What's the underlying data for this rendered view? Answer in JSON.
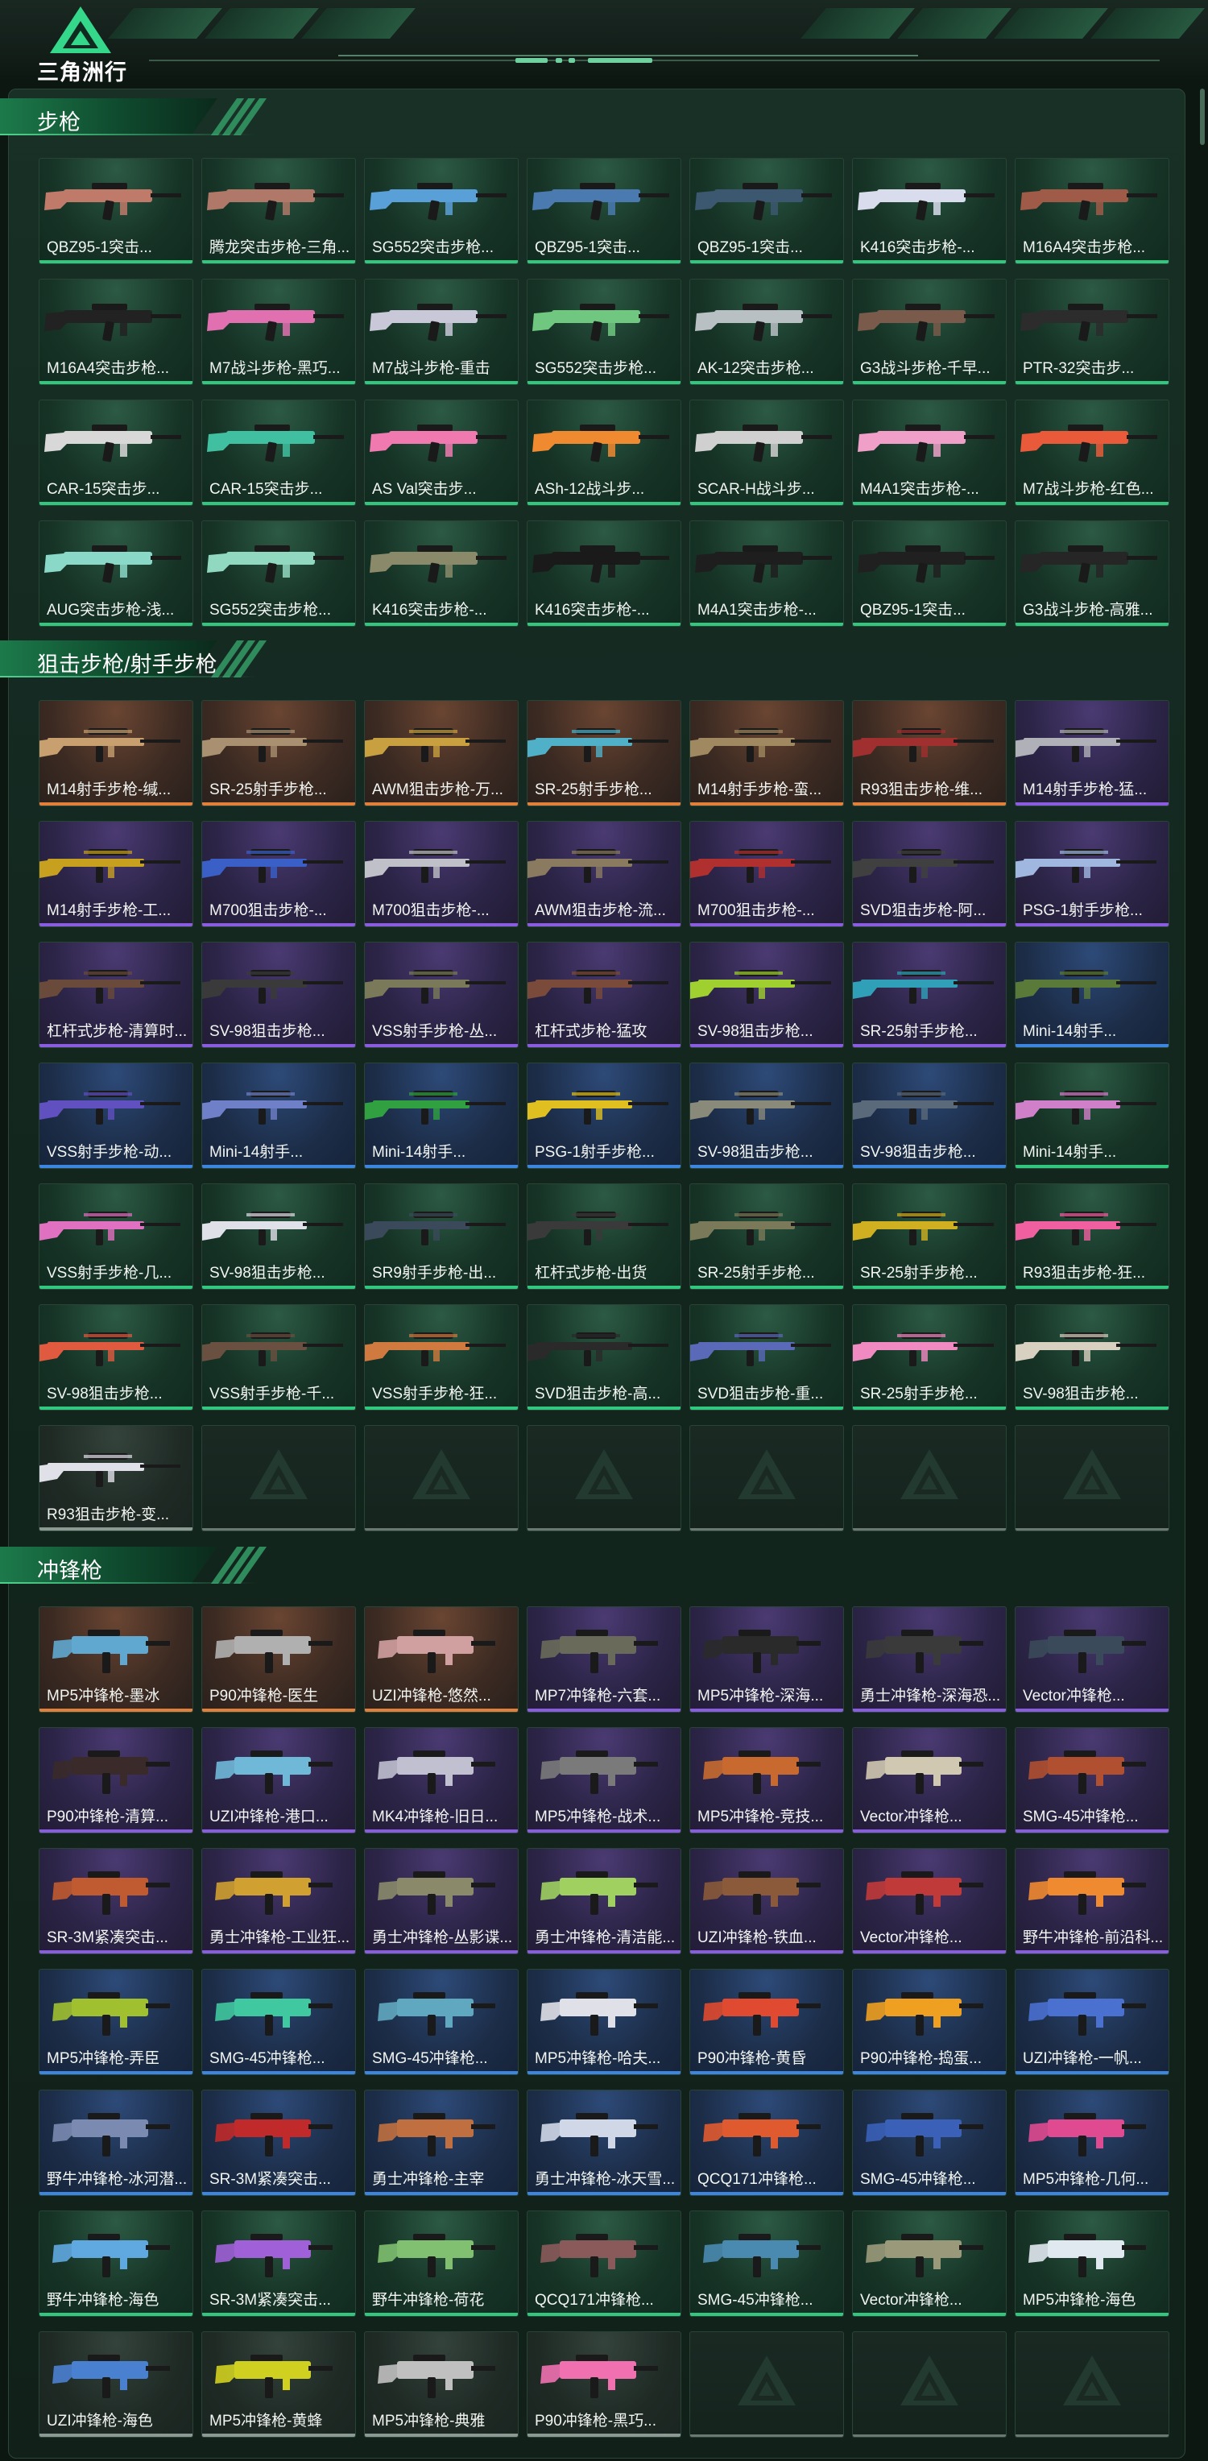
{
  "header": {
    "logo_text": "三角洲行动",
    "logo_icon": "delta-triangle-logo"
  },
  "colors": {
    "common": "#32c77f",
    "rare": "#3d86e0",
    "epic": "#8a5ce0",
    "legendary": "#e0803a",
    "empty": "#6c7872"
  },
  "sections": [
    {
      "title": "步枪",
      "items": [
        {
          "label": "QBZ95-1突击...",
          "rarity": "green",
          "color": "#c07a6a"
        },
        {
          "label": "腾龙突击步枪-三角...",
          "rarity": "green",
          "color": "#b07868"
        },
        {
          "label": "SG552突击步枪...",
          "rarity": "green",
          "color": "#5aa0d8"
        },
        {
          "label": "QBZ95-1突击...",
          "rarity": "green",
          "color": "#4a7ab0"
        },
        {
          "label": "QBZ95-1突击...",
          "rarity": "green",
          "color": "#3c5870"
        },
        {
          "label": "K416突击步枪-...",
          "rarity": "green",
          "color": "#d8dcec"
        },
        {
          "label": "M16A4突击步枪...",
          "rarity": "green",
          "color": "#a05a48"
        },
        {
          "label": "M16A4突击步枪...",
          "rarity": "green",
          "color": "#222222"
        },
        {
          "label": "M7战斗步枪-黑巧...",
          "rarity": "green",
          "color": "#e070b0"
        },
        {
          "label": "M7战斗步枪-重击",
          "rarity": "green",
          "color": "#c8c8d8"
        },
        {
          "label": "SG552突击步枪...",
          "rarity": "green",
          "color": "#70c880"
        },
        {
          "label": "AK-12突击步枪...",
          "rarity": "green",
          "color": "#b8c0c4"
        },
        {
          "label": "G3战斗步枪-千早...",
          "rarity": "green",
          "color": "#7a5a4a"
        },
        {
          "label": "PTR-32突击步...",
          "rarity": "green",
          "color": "#2c2c2c"
        },
        {
          "label": "CAR-15突击步...",
          "rarity": "green",
          "color": "#d8d8d8"
        },
        {
          "label": "CAR-15突击步...",
          "rarity": "green",
          "color": "#40c0a0"
        },
        {
          "label": "AS Val突击步...",
          "rarity": "green",
          "color": "#f07ab0"
        },
        {
          "label": "ASh-12战斗步...",
          "rarity": "green",
          "color": "#f08a30"
        },
        {
          "label": "SCAR-H战斗步...",
          "rarity": "green",
          "color": "#d0d0d0"
        },
        {
          "label": "M4A1突击步枪-...",
          "rarity": "green",
          "color": "#f0a0c8"
        },
        {
          "label": "M7战斗步枪-红色...",
          "rarity": "green",
          "color": "#e85a3a"
        },
        {
          "label": "AUG突击步枪-浅...",
          "rarity": "green",
          "color": "#8ad8c8"
        },
        {
          "label": "SG552突击步枪...",
          "rarity": "green",
          "color": "#90d8c0"
        },
        {
          "label": "K416突击步枪-...",
          "rarity": "green",
          "color": "#8a8a6a"
        },
        {
          "label": "K416突击步枪-...",
          "rarity": "green",
          "color": "#1a1a1a"
        },
        {
          "label": "M4A1突击步枪-...",
          "rarity": "green",
          "color": "#1e1e1e"
        },
        {
          "label": "QBZ95-1突击...",
          "rarity": "green",
          "color": "#202020"
        },
        {
          "label": "G3战斗步枪-高雅...",
          "rarity": "green",
          "color": "#262626"
        }
      ]
    },
    {
      "title": "狙击步枪/射手步枪",
      "items": [
        {
          "label": "M14射手步枪-缄...",
          "rarity": "orange",
          "color": "#c8a070"
        },
        {
          "label": "SR-25射手步枪...",
          "rarity": "orange",
          "color": "#a89070"
        },
        {
          "label": "AWM狙击步枪-万...",
          "rarity": "orange",
          "color": "#c8a040"
        },
        {
          "label": "SR-25射手步枪...",
          "rarity": "orange",
          "color": "#50b0c8"
        },
        {
          "label": "M14射手步枪-蛮...",
          "rarity": "orange",
          "color": "#a08860"
        },
        {
          "label": "R93狙击步枪-维...",
          "rarity": "orange",
          "color": "#a03030"
        },
        {
          "label": "M14射手步枪-猛...",
          "rarity": "purple",
          "color": "#b0b0b8"
        },
        {
          "label": "M14射手步枪-工...",
          "rarity": "purple",
          "color": "#c8a020"
        },
        {
          "label": "M700狙击步枪-...",
          "rarity": "purple",
          "color": "#3a60c8"
        },
        {
          "label": "M700狙击步枪-...",
          "rarity": "purple",
          "color": "#c0c0c8"
        },
        {
          "label": "AWM狙击步枪-流...",
          "rarity": "purple",
          "color": "#8a7a60"
        },
        {
          "label": "M700狙击步枪-...",
          "rarity": "purple",
          "color": "#b03030"
        },
        {
          "label": "SVD狙击步枪-阿...",
          "rarity": "purple",
          "color": "#404040"
        },
        {
          "label": "PSG-1射手步枪...",
          "rarity": "purple",
          "color": "#a0b8e0"
        },
        {
          "label": "杠杆式步枪-清算时...",
          "rarity": "purple",
          "color": "#6a4a3a"
        },
        {
          "label": "SV-98狙击步枪...",
          "rarity": "purple",
          "color": "#3a3a3a"
        },
        {
          "label": "VSS射手步枪-丛...",
          "rarity": "purple",
          "color": "#7a7a5a"
        },
        {
          "label": "杠杆式步枪-猛攻",
          "rarity": "purple",
          "color": "#7a4a3a"
        },
        {
          "label": "SV-98狙击步枪...",
          "rarity": "purple",
          "color": "#a0d030"
        },
        {
          "label": "SR-25射手步枪...",
          "rarity": "purple",
          "color": "#30a0b8"
        },
        {
          "label": "Mini-14射手...",
          "rarity": "blue",
          "color": "#5a7a3a"
        },
        {
          "label": "VSS射手步枪-动...",
          "rarity": "blue",
          "color": "#6050c0"
        },
        {
          "label": "Mini-14射手...",
          "rarity": "blue",
          "color": "#7080c8"
        },
        {
          "label": "Mini-14射手...",
          "rarity": "blue",
          "color": "#30a040"
        },
        {
          "label": "PSG-1射手步枪...",
          "rarity": "blue",
          "color": "#e0c020"
        },
        {
          "label": "SV-98狙击步枪...",
          "rarity": "blue",
          "color": "#8a8a7a"
        },
        {
          "label": "SV-98狙击步枪...",
          "rarity": "blue",
          "color": "#5a6a7a"
        },
        {
          "label": "Mini-14射手...",
          "rarity": "green",
          "color": "#d080c8"
        },
        {
          "label": "VSS射手步枪-几...",
          "rarity": "green",
          "color": "#e070c0"
        },
        {
          "label": "SV-98狙击步枪...",
          "rarity": "green",
          "color": "#e0e0e8"
        },
        {
          "label": "SR9射手步枪-出...",
          "rarity": "green",
          "color": "#3a4a5a"
        },
        {
          "label": "杠杆式步枪-出货",
          "rarity": "green",
          "color": "#3a3a3a"
        },
        {
          "label": "SR-25射手步枪...",
          "rarity": "green",
          "color": "#7a7a5a"
        },
        {
          "label": "SR-25射手步枪...",
          "rarity": "green",
          "color": "#d0b020"
        },
        {
          "label": "R93狙击步枪-狂...",
          "rarity": "green",
          "color": "#f060a0"
        },
        {
          "label": "SV-98狙击步枪...",
          "rarity": "green",
          "color": "#e05a40"
        },
        {
          "label": "VSS射手步枪-千...",
          "rarity": "green",
          "color": "#6a5040"
        },
        {
          "label": "VSS射手步枪-狂...",
          "rarity": "green",
          "color": "#d07a40"
        },
        {
          "label": "SVD狙击步枪-高...",
          "rarity": "green",
          "color": "#2a2a2a"
        },
        {
          "label": "SVD狙击步枪-重...",
          "rarity": "green",
          "color": "#5a6ab8"
        },
        {
          "label": "SR-25射手步枪...",
          "rarity": "green",
          "color": "#f08ac0"
        },
        {
          "label": "SV-98狙击步枪...",
          "rarity": "green",
          "color": "#d8d0c0"
        },
        {
          "label": "R93狙击步枪-变...",
          "rarity": "gray",
          "color": "#e0e0e8"
        },
        {
          "label": "",
          "rarity": "empty",
          "color": ""
        },
        {
          "label": "",
          "rarity": "empty",
          "color": ""
        },
        {
          "label": "",
          "rarity": "empty",
          "color": ""
        },
        {
          "label": "",
          "rarity": "empty",
          "color": ""
        },
        {
          "label": "",
          "rarity": "empty",
          "color": ""
        },
        {
          "label": "",
          "rarity": "empty",
          "color": ""
        }
      ]
    },
    {
      "title": "冲锋枪",
      "items": [
        {
          "label": "MP5冲锋枪-墨冰",
          "rarity": "orange",
          "color": "#60a8d0"
        },
        {
          "label": "P90冲锋枪-医生",
          "rarity": "orange",
          "color": "#b0b0b0"
        },
        {
          "label": "UZI冲锋枪-悠然...",
          "rarity": "orange",
          "color": "#d0a0a0"
        },
        {
          "label": "MP7冲锋枪-六套...",
          "rarity": "purple",
          "color": "#6a6a5a"
        },
        {
          "label": "MP5冲锋枪-深海...",
          "rarity": "purple",
          "color": "#2a2a2a"
        },
        {
          "label": "勇士冲锋枪-深海恐...",
          "rarity": "purple",
          "color": "#3a3a3a"
        },
        {
          "label": "Vector冲锋枪...",
          "rarity": "purple",
          "color": "#3a4a5a"
        },
        {
          "label": "P90冲锋枪-清算...",
          "rarity": "purple",
          "color": "#3a2a2a"
        },
        {
          "label": "UZI冲锋枪-港口...",
          "rarity": "purple",
          "color": "#70b8d8"
        },
        {
          "label": "MK4冲锋枪-旧日...",
          "rarity": "purple",
          "color": "#c0c0d0"
        },
        {
          "label": "MP5冲锋枪-战术...",
          "rarity": "purple",
          "color": "#7a7a7a"
        },
        {
          "label": "MP5冲锋枪-竞技...",
          "rarity": "purple",
          "color": "#c86a30"
        },
        {
          "label": "Vector冲锋枪...",
          "rarity": "purple",
          "color": "#d0c8b0"
        },
        {
          "label": "SMG-45冲锋枪...",
          "rarity": "purple",
          "color": "#b05030"
        },
        {
          "label": "SR-3M紧凑突击...",
          "rarity": "purple",
          "color": "#c05a30"
        },
        {
          "label": "勇士冲锋枪-工业狂...",
          "rarity": "purple",
          "color": "#d0a030"
        },
        {
          "label": "勇士冲锋枪-丛影谍...",
          "rarity": "purple",
          "color": "#8a8a6a"
        },
        {
          "label": "勇士冲锋枪-清洁能...",
          "rarity": "purple",
          "color": "#a0d060"
        },
        {
          "label": "UZI冲锋枪-铁血...",
          "rarity": "purple",
          "color": "#8a5a3a"
        },
        {
          "label": "Vector冲锋枪...",
          "rarity": "purple",
          "color": "#c03a3a"
        },
        {
          "label": "野牛冲锋枪-前沿科...",
          "rarity": "purple",
          "color": "#f08a30"
        },
        {
          "label": "MP5冲锋枪-弄臣",
          "rarity": "blue",
          "color": "#a0c030"
        },
        {
          "label": "SMG-45冲锋枪...",
          "rarity": "blue",
          "color": "#40c8a0"
        },
        {
          "label": "SMG-45冲锋枪...",
          "rarity": "blue",
          "color": "#60a8c0"
        },
        {
          "label": "MP5冲锋枪-哈夫...",
          "rarity": "blue",
          "color": "#e0e0e8"
        },
        {
          "label": "P90冲锋枪-黄昏",
          "rarity": "blue",
          "color": "#e04a30"
        },
        {
          "label": "P90冲锋枪-捣蛋...",
          "rarity": "blue",
          "color": "#f0a020"
        },
        {
          "label": "UZI冲锋枪-一帆...",
          "rarity": "blue",
          "color": "#4a70d0"
        },
        {
          "label": "野牛冲锋枪-冰河潜...",
          "rarity": "blue",
          "color": "#7a8ab0"
        },
        {
          "label": "SR-3M紧凑突击...",
          "rarity": "blue",
          "color": "#c02a2a"
        },
        {
          "label": "勇士冲锋枪-主宰",
          "rarity": "blue",
          "color": "#c07040"
        },
        {
          "label": "勇士冲锋枪-冰天雪...",
          "rarity": "blue",
          "color": "#d0d8e8"
        },
        {
          "label": "QCQ171冲锋枪...",
          "rarity": "blue",
          "color": "#e05a30"
        },
        {
          "label": "SMG-45冲锋枪...",
          "rarity": "blue",
          "color": "#3a60b8"
        },
        {
          "label": "MP5冲锋枪-几何...",
          "rarity": "blue",
          "color": "#e04a90"
        },
        {
          "label": "野牛冲锋枪-海色",
          "rarity": "green",
          "color": "#60a8e0"
        },
        {
          "label": "SR-3M紧凑突击...",
          "rarity": "green",
          "color": "#a060d8"
        },
        {
          "label": "野牛冲锋枪-荷花",
          "rarity": "green",
          "color": "#80c070"
        },
        {
          "label": "QCQ171冲锋枪...",
          "rarity": "green",
          "color": "#8a5a5a"
        },
        {
          "label": "SMG-45冲锋枪...",
          "rarity": "green",
          "color": "#4a8ab0"
        },
        {
          "label": "Vector冲锋枪...",
          "rarity": "green",
          "color": "#9a9a7a"
        },
        {
          "label": "MP5冲锋枪-海色",
          "rarity": "green",
          "color": "#e0e8f0"
        },
        {
          "label": "UZI冲锋枪-海色",
          "rarity": "gray",
          "color": "#4a80d0"
        },
        {
          "label": "MP5冲锋枪-黄蜂",
          "rarity": "gray",
          "color": "#d0d020"
        },
        {
          "label": "MP5冲锋枪-典雅",
          "rarity": "gray",
          "color": "#c0c0c0"
        },
        {
          "label": "P90冲锋枪-黑巧...",
          "rarity": "gray",
          "color": "#f070b0"
        },
        {
          "label": "",
          "rarity": "empty",
          "color": ""
        },
        {
          "label": "",
          "rarity": "empty",
          "color": ""
        },
        {
          "label": "",
          "rarity": "empty",
          "color": ""
        }
      ]
    }
  ]
}
